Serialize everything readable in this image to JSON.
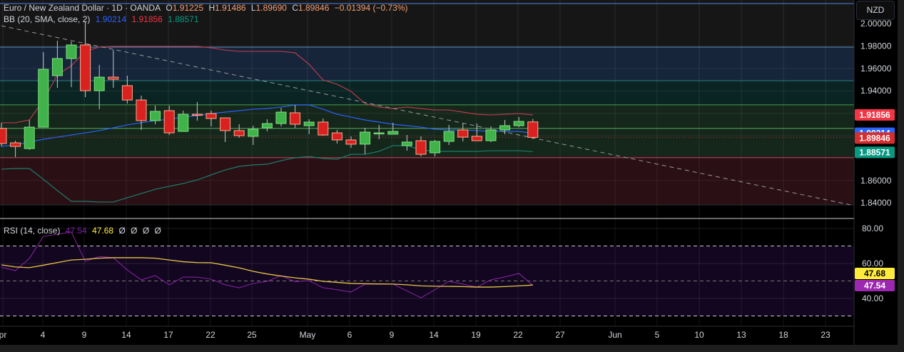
{
  "header": {
    "symbol": "Euro / New Zealand Dollar · 1D · OANDA",
    "open_label": "O",
    "open": "1.91225",
    "high_label": "H",
    "high": "1.91486",
    "low_label": "L",
    "low": "1.89690",
    "close_label": "C",
    "close": "1.89846",
    "change": "−0.01394 (−0.73%)"
  },
  "bb": {
    "label": "BB (20, SMA, close, 2)",
    "basis": "1.90214",
    "upper": "1.91856",
    "lower": "1.88571"
  },
  "rsi": {
    "label": "RSI (14, close)",
    "value": "47.54",
    "ma": "47.68",
    "extras": [
      "Ø",
      "Ø",
      "Ø",
      "Ø"
    ]
  },
  "currency_button": "NZD",
  "colors": {
    "up": "#3fb34a",
    "down": "#d9221f",
    "upper_band": "#b73b4c",
    "basis": "#2962ff",
    "lower_band": "#1c7f6b",
    "rsi": "#8e24aa",
    "rsi_ma": "#e8c547",
    "badge_upper": "#f23645",
    "badge_basis": "#2962ff",
    "badge_close": "#d32f2f",
    "badge_lower": "#089981",
    "badge_rsi_ma": "#ffeb3b",
    "badge_rsi": "#9c27b0"
  },
  "price_axis": [
    "2.00000",
    "1.98000",
    "1.96000",
    "1.94000",
    "1.86000",
    "1.84000"
  ],
  "rsi_axis": [
    "80.00",
    "60.00",
    "40.00"
  ],
  "time_axis": [
    "pr",
    "4",
    "9",
    "14",
    "17",
    "22",
    "25",
    "May",
    "6",
    "9",
    "14",
    "19",
    "22",
    "27",
    "Jun",
    "5",
    "10",
    "13",
    "18",
    "23"
  ],
  "chart_data": {
    "type": "candlestick",
    "price_range": [
      1.84,
      2.0
    ],
    "candles": [
      [
        1.9064,
        1.9115,
        1.8904,
        1.893
      ],
      [
        1.8936,
        1.8955,
        1.8809,
        1.8904
      ],
      [
        1.8885,
        1.914,
        1.8873,
        1.9076
      ],
      [
        1.9076,
        1.9745,
        1.9076,
        1.9592
      ],
      [
        1.9535,
        1.9847,
        1.9427,
        1.9688
      ],
      [
        1.9688,
        1.9841,
        1.9433,
        1.9809
      ],
      [
        1.9809,
        2.0019,
        1.9344,
        1.9401
      ],
      [
        1.9401,
        1.9631,
        1.9236,
        1.9522
      ],
      [
        1.9522,
        1.9764,
        1.9427,
        1.9503
      ],
      [
        1.9446,
        1.9535,
        1.9287,
        1.9318
      ],
      [
        1.9318,
        1.9357,
        1.9051,
        1.9134
      ],
      [
        1.9134,
        1.9268,
        1.9102,
        1.9217
      ],
      [
        1.9223,
        1.9268,
        1.9006,
        1.9025
      ],
      [
        1.9038,
        1.9223,
        1.9038,
        1.9191
      ],
      [
        1.9191,
        1.9299,
        1.9134,
        1.9185
      ],
      [
        1.9197,
        1.9223,
        1.9083,
        1.9153
      ],
      [
        1.9159,
        1.9159,
        1.8943,
        1.9045
      ],
      [
        1.9045,
        1.9102,
        1.8981,
        1.9
      ],
      [
        1.8994,
        1.9089,
        1.8917,
        1.9057
      ],
      [
        1.907,
        1.9146,
        1.9038,
        1.9108
      ],
      [
        1.9108,
        1.9248,
        1.9083,
        1.921
      ],
      [
        1.9204,
        1.9274,
        1.907,
        1.9102
      ],
      [
        1.9089,
        1.9146,
        1.9013,
        1.9121
      ],
      [
        1.9121,
        1.9153,
        1.9,
        1.9006
      ],
      [
        1.9025,
        1.9051,
        1.893,
        1.8962
      ],
      [
        1.8962,
        1.8994,
        1.8892,
        1.8924
      ],
      [
        1.8924,
        1.907,
        1.8834,
        1.9032
      ],
      [
        1.9019,
        1.9096,
        1.8968,
        1.9025
      ],
      [
        1.9013,
        1.9115,
        1.9013,
        1.9038
      ],
      [
        1.8911,
        1.9006,
        1.8866,
        1.8943
      ],
      [
        1.8955,
        1.8994,
        1.8815,
        1.8834
      ],
      [
        1.8847,
        1.8962,
        1.8815,
        1.8949
      ],
      [
        1.8949,
        1.9096,
        1.8917,
        1.9038
      ],
      [
        1.9051,
        1.9108,
        1.8949,
        1.8987
      ],
      [
        1.8994,
        1.9108,
        1.8955,
        1.8955
      ],
      [
        1.8955,
        1.9083,
        1.8943,
        1.9051
      ],
      [
        1.9051,
        1.914,
        1.9013,
        1.9089
      ],
      [
        1.9089,
        1.9166,
        1.9076,
        1.9127
      ],
      [
        1.91225,
        1.91486,
        1.8969,
        1.89846
      ]
    ],
    "bb_upper": [
      1.9115,
      1.9115,
      1.914,
      1.9318,
      1.9541,
      1.9624,
      1.9752,
      1.979,
      1.9796,
      1.9796,
      1.9796,
      1.9796,
      1.9796,
      1.9796,
      1.9796,
      1.9783,
      1.9764,
      1.9752,
      1.9752,
      1.9752,
      1.9752,
      1.9739,
      1.9637,
      1.9497,
      1.9459,
      1.9395,
      1.9287,
      1.9255,
      1.9242,
      1.9255,
      1.9242,
      1.9229,
      1.9229,
      1.921,
      1.9191,
      1.9185,
      1.9191,
      1.9197,
      1.91856
    ],
    "bb_basis": [
      1.8904,
      1.8917,
      1.8943,
      1.8968,
      1.8987,
      1.9006,
      1.9025,
      1.9045,
      1.907,
      1.9096,
      1.9115,
      1.9134,
      1.9146,
      1.9166,
      1.9178,
      1.9197,
      1.921,
      1.9223,
      1.9236,
      1.9242,
      1.9255,
      1.9274,
      1.9274,
      1.9236,
      1.9191,
      1.9166,
      1.914,
      1.9121,
      1.9102,
      1.9089,
      1.9076,
      1.9057,
      1.9051,
      1.9051,
      1.9045,
      1.9038,
      1.9038,
      1.9038,
      1.90214
    ],
    "bb_lower": [
      1.8701,
      1.8707,
      1.8707,
      1.8611,
      1.851,
      1.8414,
      1.8414,
      1.8408,
      1.8408,
      1.8446,
      1.8484,
      1.8522,
      1.8548,
      1.8573,
      1.8605,
      1.865,
      1.8694,
      1.8726,
      1.8739,
      1.8745,
      1.8777,
      1.8803,
      1.8815,
      1.8796,
      1.879,
      1.8834,
      1.8834,
      1.886,
      1.8911,
      1.8911,
      1.8873,
      1.886,
      1.886,
      1.886,
      1.886,
      1.8866,
      1.8866,
      1.8866,
      1.88571
    ],
    "levels": [
      1.979,
      1.949,
      1.9275,
      1.9065,
      1.8805
    ],
    "trendline": [
      [
        0,
        1.998
      ],
      [
        61,
        1.8375
      ]
    ],
    "rsi_range": [
      20,
      85
    ],
    "rsi_bands": [
      70,
      50,
      30
    ],
    "rsi": [
      57.8,
      55.9,
      62.9,
      75.5,
      76.7,
      78,
      61.2,
      64,
      63.3,
      56.3,
      50.6,
      53.1,
      47.8,
      52.2,
      52.2,
      51,
      47.8,
      46.1,
      48.6,
      49.8,
      53.1,
      49.6,
      50.2,
      46.1,
      45,
      43.7,
      48.2,
      48.2,
      48.2,
      44.3,
      40.4,
      45,
      49.8,
      48.2,
      46.5,
      50.6,
      52.3,
      54.3,
      47.54
    ],
    "rsi_ma": [
      59.2,
      58,
      57.6,
      59,
      60.5,
      62,
      62.4,
      63,
      63.3,
      63.3,
      63.3,
      63,
      62,
      61,
      60.5,
      60.4,
      59,
      57.5,
      55.5,
      54,
      52.8,
      51.8,
      51,
      49.8,
      49.2,
      48.6,
      48.4,
      48.3,
      48.2,
      47.8,
      47.2,
      47,
      46.9,
      46.8,
      46.5,
      46.5,
      46.8,
      47.2,
      47.68
    ]
  }
}
